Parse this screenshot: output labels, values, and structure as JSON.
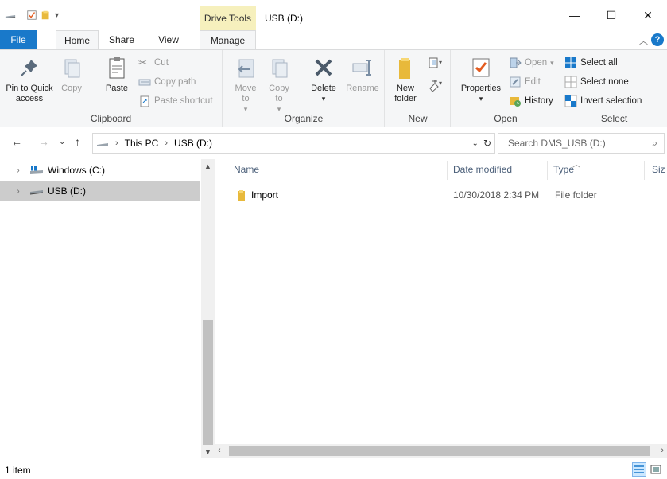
{
  "titlebar": {
    "contextual_tab_label": "Drive Tools",
    "title": "USB (D:)",
    "minimize_glyph": "—",
    "maximize_glyph": "☐",
    "close_glyph": "✕"
  },
  "tabs": [
    {
      "label": "File"
    },
    {
      "label": "Home"
    },
    {
      "label": "Share"
    },
    {
      "label": "View"
    },
    {
      "label": "Manage"
    }
  ],
  "ribbon": {
    "clipboard": {
      "label": "Clipboard",
      "pin_label": "Pin to Quick access",
      "copy_label": "Copy",
      "paste_label": "Paste",
      "cut_label": "Cut",
      "copy_path_label": "Copy path",
      "paste_shortcut_label": "Paste shortcut"
    },
    "organize": {
      "label": "Organize",
      "move_to_label": "Move to",
      "copy_to_label": "Copy to",
      "delete_label": "Delete",
      "rename_label": "Rename"
    },
    "new": {
      "label": "New",
      "new_folder_label": "New folder"
    },
    "open": {
      "label": "Open",
      "properties_label": "Properties",
      "open_label": "Open",
      "edit_label": "Edit",
      "history_label": "History"
    },
    "select": {
      "label": "Select",
      "select_all_label": "Select all",
      "select_none_label": "Select none",
      "invert_selection_label": "Invert selection"
    }
  },
  "address": {
    "crumbs": [
      "This PC",
      "USB (D:)"
    ],
    "search_placeholder": "Search DMS_USB (D:)"
  },
  "nav": {
    "items": [
      {
        "label": "Windows (C:)"
      },
      {
        "label": "USB (D:)"
      }
    ]
  },
  "columns": [
    "Name",
    "Date modified",
    "Type",
    "Siz"
  ],
  "files": [
    {
      "name": "Import",
      "date_modified": "10/30/2018 2:34 PM",
      "type": "File folder"
    }
  ],
  "status": {
    "item_count": "1 item"
  },
  "colors": {
    "file_tab": "#1979ca",
    "drive_tools": "#f6f0bd",
    "selected_nav": "#cccccc",
    "folder": "#e8b93b"
  }
}
